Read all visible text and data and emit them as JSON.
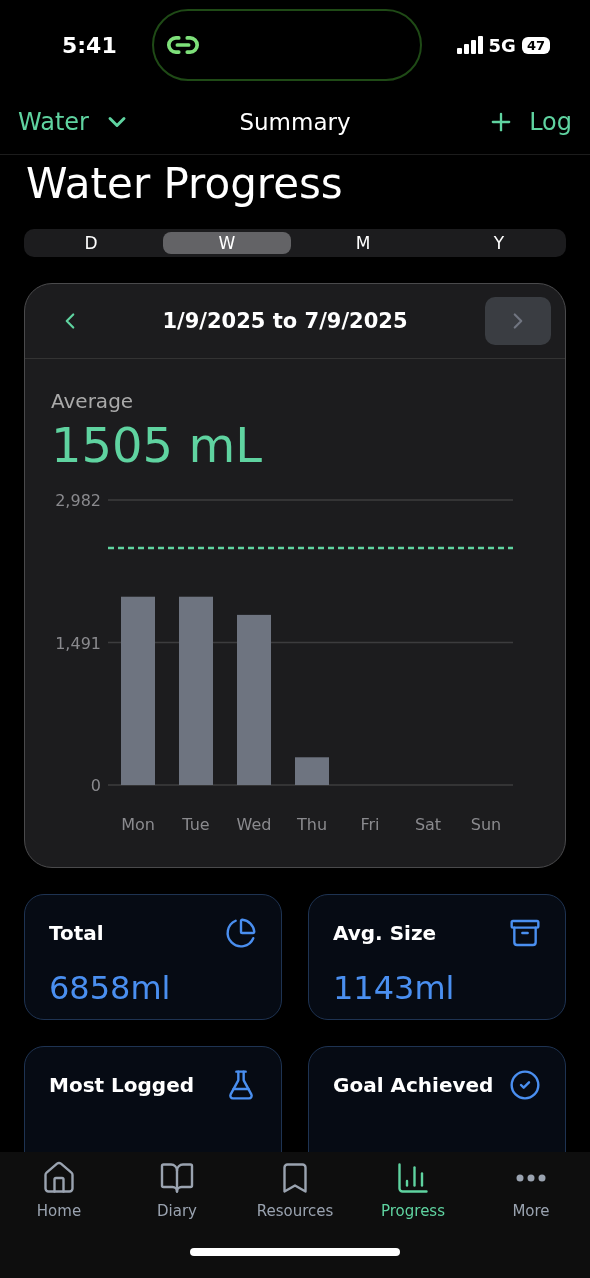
{
  "status_bar": {
    "time": "5:41",
    "network": "5G",
    "battery": "47"
  },
  "nav": {
    "left": "Water",
    "title": "Summary",
    "right": "Log"
  },
  "heading": "Water Progress",
  "periods": [
    {
      "label": "D",
      "selected": false
    },
    {
      "label": "W",
      "selected": true
    },
    {
      "label": "M",
      "selected": false
    },
    {
      "label": "Y",
      "selected": false
    }
  ],
  "range": {
    "label": "1/9/2025 to 7/9/2025",
    "next_disabled": true
  },
  "average": {
    "label": "Average",
    "value": "1505 mL"
  },
  "chart_data": {
    "type": "bar",
    "categories": [
      "Mon",
      "Tue",
      "Wed",
      "Thu",
      "Fri",
      "Sat",
      "Sun"
    ],
    "values": [
      1970,
      1970,
      1780,
      290,
      null,
      null,
      null
    ],
    "ylim": [
      0,
      2982
    ],
    "yticks": [
      {
        "value": 0,
        "label": "0"
      },
      {
        "value": 1491,
        "label": "1,491"
      },
      {
        "value": 2982,
        "label": "2,982"
      }
    ],
    "ref_lines": [
      {
        "axis": "y",
        "value": 2480
      }
    ]
  },
  "stats": [
    {
      "label": "Total",
      "value": "6858ml"
    },
    {
      "label": "Avg. Size",
      "value": "1143ml"
    },
    {
      "label": "Most Logged"
    },
    {
      "label": "Goal Achieved"
    }
  ],
  "tabs": [
    {
      "label": "Home",
      "selected": false
    },
    {
      "label": "Diary",
      "selected": false
    },
    {
      "label": "Resources",
      "selected": false
    },
    {
      "label": "Progress",
      "selected": true
    },
    {
      "label": "More",
      "selected": false
    }
  ]
}
